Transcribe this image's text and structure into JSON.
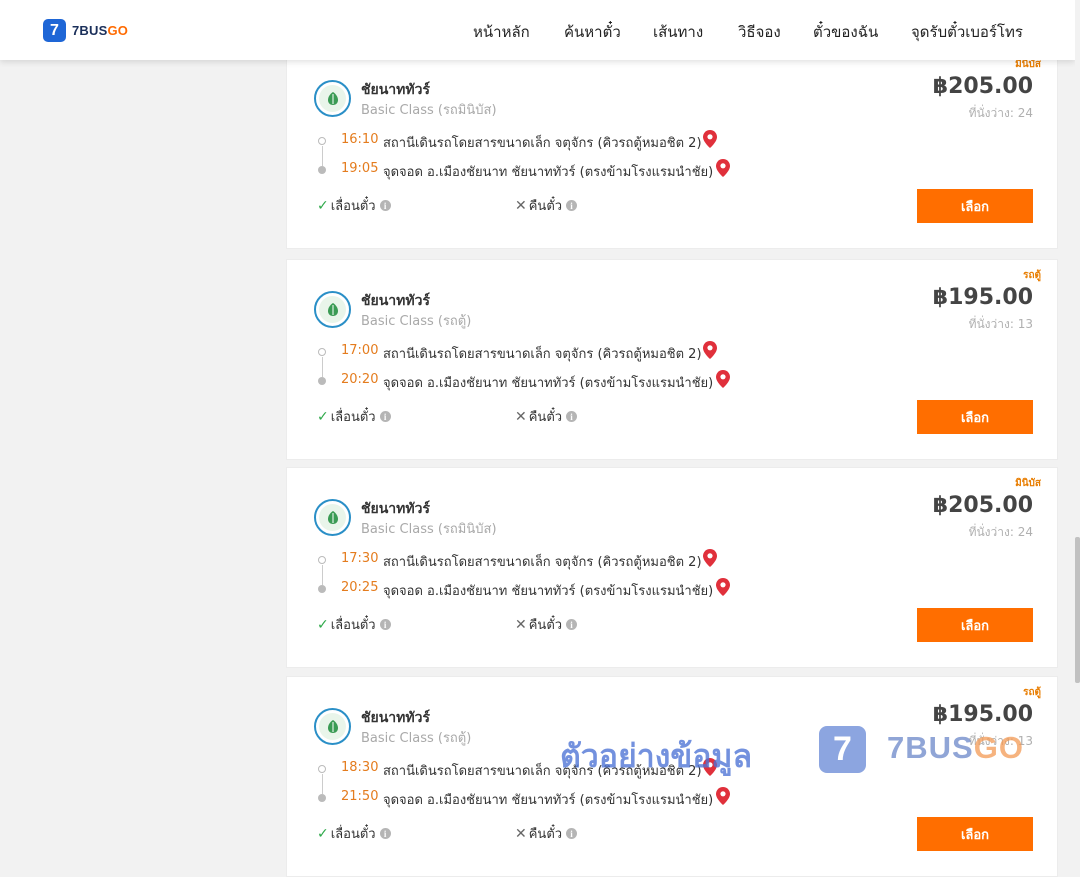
{
  "header": {
    "logo_mark": "7",
    "logo_text_a": "7BUS",
    "logo_text_b": "GO",
    "nav": [
      {
        "label": "หน้าหลัก"
      },
      {
        "label": "ค้นหาตั๋ว"
      },
      {
        "label": "เส้นทาง"
      },
      {
        "label": "วิธีจอง"
      },
      {
        "label": "ตั๋วของฉัน"
      },
      {
        "label": "จุดรับตั๋วเบอร์โทร"
      }
    ]
  },
  "trips": [
    {
      "tag": "มินิบัส",
      "operator": "ชัยนาททัวร์",
      "class": "Basic Class (รถมินิบัส)",
      "price": "฿205.00",
      "seats": "ที่นั่งว่าง: 24",
      "depart_time": "16:10",
      "depart_place": "สถานีเดินรถโดยสารขนาดเล็ก จตุจักร (คิวรถตู้หมอชิต 2)",
      "arrive_time": "19:05",
      "arrive_place": "จุดจอด อ.เมืองชัยนาท ชัยนาททัวร์ (ตรงข้ามโรงแรมนำชัย)",
      "reschedule": "เลื่อนตั๋ว",
      "refund": "คืนตั๋ว",
      "select": "เลือก"
    },
    {
      "tag": "รถตู้",
      "operator": "ชัยนาททัวร์",
      "class": "Basic Class (รถตู้)",
      "price": "฿195.00",
      "seats": "ที่นั่งว่าง: 13",
      "depart_time": "17:00",
      "depart_place": "สถานีเดินรถโดยสารขนาดเล็ก จตุจักร (คิวรถตู้หมอชิต 2)",
      "arrive_time": "20:20",
      "arrive_place": "จุดจอด อ.เมืองชัยนาท ชัยนาททัวร์ (ตรงข้ามโรงแรมนำชัย)",
      "reschedule": "เลื่อนตั๋ว",
      "refund": "คืนตั๋ว",
      "select": "เลือก"
    },
    {
      "tag": "มินิบัส",
      "operator": "ชัยนาททัวร์",
      "class": "Basic Class (รถมินิบัส)",
      "price": "฿205.00",
      "seats": "ที่นั่งว่าง: 24",
      "depart_time": "17:30",
      "depart_place": "สถานีเดินรถโดยสารขนาดเล็ก จตุจักร (คิวรถตู้หมอชิต 2)",
      "arrive_time": "20:25",
      "arrive_place": "จุดจอด อ.เมืองชัยนาท ชัยนาททัวร์ (ตรงข้ามโรงแรมนำชัย)",
      "reschedule": "เลื่อนตั๋ว",
      "refund": "คืนตั๋ว",
      "select": "เลือก"
    },
    {
      "tag": "รถตู้",
      "operator": "ชัยนาททัวร์",
      "class": "Basic Class (รถตู้)",
      "price": "฿195.00",
      "seats": "ที่นั่งว่าง: 13",
      "depart_time": "18:30",
      "depart_place": "สถานีเดินรถโดยสารขนาดเล็ก จตุจักร (คิวรถตู้หมอชิต 2)",
      "arrive_time": "21:50",
      "arrive_place": "จุดจอด อ.เมืองชัยนาท ชัยนาททัวร์ (ตรงข้ามโรงแรมนำชัย)",
      "reschedule": "เลื่อนตั๋ว",
      "refund": "คืนตั๋ว",
      "select": "เลือก"
    }
  ],
  "watermark": {
    "text": "ตัวอย่างข้อมูล",
    "logo_mark": "7",
    "brand_a": "7BUS",
    "brand_b": "GO"
  },
  "colors": {
    "accent": "#ff6e00",
    "time": "#e47c1e",
    "brand_blue": "#1e66d6",
    "pin": "#e0303b",
    "check": "#2ea94a"
  }
}
